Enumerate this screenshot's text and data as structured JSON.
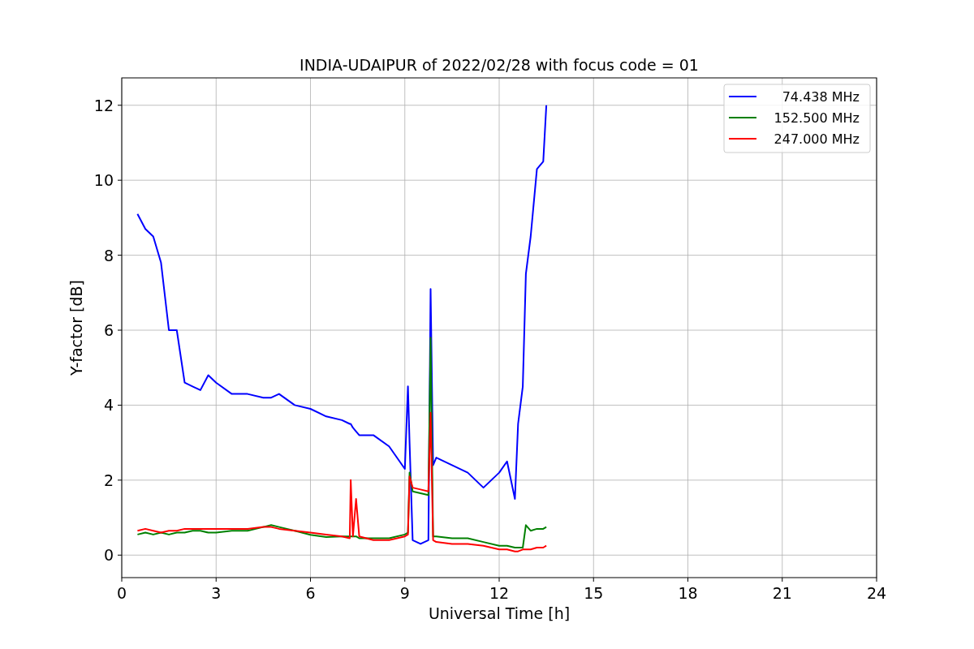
{
  "figure": {
    "chart_data": {
      "type": "line",
      "grid": true,
      "legend": true,
      "title": "INDIA-UDAIPUR of 2022/02/28 with focus code = 01",
      "xlabel": "Universal Time [h]",
      "ylabel": "Y-factor [dB]",
      "xlim": [
        0,
        24
      ],
      "ylim": [
        -0.6,
        12.73
      ],
      "xticks": [
        0,
        3,
        6,
        9,
        12,
        15,
        18,
        21,
        24
      ],
      "yticks": [
        0,
        2,
        4,
        6,
        8,
        10,
        12
      ],
      "x": [
        0.5,
        0.75,
        1,
        1.25,
        1.5,
        1.75,
        2,
        2.25,
        2.5,
        2.75,
        3,
        3.5,
        4,
        4.5,
        4.75,
        5,
        5.5,
        6,
        6.5,
        7,
        7.25,
        7.28,
        7.35,
        7.45,
        7.55,
        8,
        8.5,
        9,
        9.1,
        9.15,
        9.25,
        9.5,
        9.75,
        9.82,
        9.9,
        10,
        10.5,
        11,
        11.5,
        12,
        12.25,
        12.5,
        12.6,
        12.75,
        12.85,
        13,
        13.2,
        13.4,
        13.5
      ],
      "series": [
        {
          "name": "74.438 MHz",
          "color": "#0000ff",
          "values": [
            9.1,
            8.7,
            8.5,
            7.8,
            6.0,
            6.0,
            4.6,
            4.5,
            4.4,
            4.8,
            4.6,
            4.3,
            4.3,
            4.2,
            4.2,
            4.3,
            4.0,
            3.9,
            3.7,
            3.6,
            3.5,
            3.5,
            3.4,
            3.3,
            3.2,
            3.2,
            2.9,
            2.3,
            4.5,
            3.0,
            0.4,
            0.3,
            0.4,
            7.1,
            2.4,
            2.6,
            2.4,
            2.2,
            1.8,
            2.2,
            2.5,
            1.5,
            3.5,
            4.5,
            7.5,
            8.5,
            10.3,
            10.5,
            12.0
          ]
        },
        {
          "name": "152.500 MHz",
          "color": "#008000",
          "values": [
            0.55,
            0.6,
            0.55,
            0.6,
            0.55,
            0.6,
            0.6,
            0.65,
            0.65,
            0.6,
            0.6,
            0.65,
            0.65,
            0.75,
            0.8,
            0.75,
            0.65,
            0.54,
            0.48,
            0.5,
            0.5,
            0.5,
            0.5,
            0.5,
            0.45,
            0.45,
            0.45,
            0.55,
            0.6,
            2.2,
            1.7,
            1.65,
            1.6,
            5.8,
            0.5,
            0.5,
            0.45,
            0.45,
            0.35,
            0.25,
            0.25,
            0.2,
            0.2,
            0.2,
            0.8,
            0.65,
            0.7,
            0.7,
            0.75
          ]
        },
        {
          "name": "247.000 MHz",
          "color": "#ff0000",
          "values": [
            0.65,
            0.7,
            0.65,
            0.6,
            0.65,
            0.65,
            0.7,
            0.7,
            0.7,
            0.7,
            0.7,
            0.7,
            0.7,
            0.75,
            0.75,
            0.7,
            0.65,
            0.6,
            0.55,
            0.5,
            0.45,
            2.0,
            0.5,
            1.5,
            0.5,
            0.4,
            0.4,
            0.5,
            0.55,
            2.1,
            1.8,
            1.75,
            1.7,
            3.8,
            0.4,
            0.35,
            0.3,
            0.3,
            0.25,
            0.15,
            0.15,
            0.1,
            0.1,
            0.15,
            0.15,
            0.15,
            0.2,
            0.2,
            0.25
          ]
        }
      ]
    }
  }
}
